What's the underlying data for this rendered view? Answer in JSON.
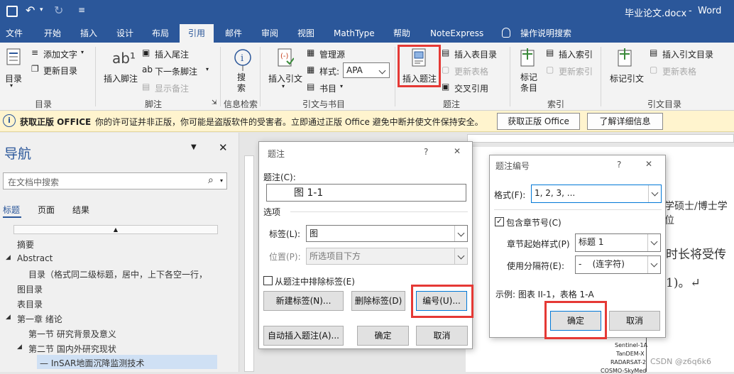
{
  "titlebar": {
    "filename": "毕业论文.docx",
    "dash": "-",
    "app": "Word"
  },
  "tabs": [
    "文件",
    "开始",
    "插入",
    "设计",
    "布局",
    "引用",
    "邮件",
    "审阅",
    "视图",
    "MathType",
    "帮助",
    "NoteExpress",
    "操作说明搜索"
  ],
  "ribbon": {
    "toc": {
      "label": "目录",
      "add_text": "添加文字",
      "update_toc": "更新目录",
      "group": "目录"
    },
    "footnote": {
      "insert": "插入脚注",
      "insert_endnote": "插入尾注",
      "next": "下一条脚注",
      "show": "显示备注",
      "group": "脚注"
    },
    "search": {
      "label": "搜索",
      "group": "信息检索"
    },
    "citation": {
      "insert": "插入引文",
      "manage": "管理源",
      "style_label": "样式:",
      "style_value": "APA",
      "bib": "书目",
      "group": "引文与书目"
    },
    "caption": {
      "insert": "插入题注",
      "table_of_figures": "插入表目录",
      "update_table": "更新表格",
      "cross_ref": "交叉引用",
      "group": "题注"
    },
    "index": {
      "mark": "标记条目",
      "insert": "插入索引",
      "update": "更新索引",
      "group": "索引"
    },
    "authorities": {
      "mark": "标记引文",
      "insert": "插入引文目录",
      "update": "更新表格",
      "group": "引文目录"
    }
  },
  "message_bar": {
    "title": "获取正版 OFFICE",
    "text": "你的许可证并非正版，你可能是盗版软件的受害者。立即通过正版 Office 避免中断并使文件保持安全。",
    "btn_get": "获取正版 Office",
    "btn_more": "了解详细信息"
  },
  "nav": {
    "title": "导航",
    "search_placeholder": "在文档中搜索",
    "tabs": [
      "标题",
      "页面",
      "结果"
    ],
    "items": [
      "摘要",
      "Abstract",
      "目录（格式同二级标题，居中，上下各空一行，",
      "图目录",
      "表目录",
      "第一章 绪论",
      "第一节 研究背景及意义",
      "第二节 国内外研究现状",
      "— InSAR地面沉降监测技术"
    ]
  },
  "doc": {
    "text1": "学硕士/博士学位",
    "text2": "时长将受传",
    "text3": "1)。↵",
    "figure_labels": [
      "Sentinel-1A",
      "TanDEM-X",
      "RADARSAT-2",
      "COSMO-SkyMed"
    ],
    "watermark": "CSDN @z6q6k6"
  },
  "caption_dialog": {
    "title": "题注",
    "help": "?",
    "close": "✕",
    "caption_label": "题注(C):",
    "caption_value": "图  1-1",
    "options": "选项",
    "label_label": "标签(L):",
    "label_value": "图",
    "position_label": "位置(P):",
    "position_value": "所选项目下方",
    "exclude": "从题注中排除标签(E)",
    "new_label": "新建标签(N)...",
    "delete_label": "删除标签(D)",
    "numbering": "编号(U)...",
    "autocaption": "自动插入题注(A)...",
    "ok": "确定",
    "cancel": "取消"
  },
  "numbering_dialog": {
    "title": "题注编号",
    "help": "?",
    "close": "✕",
    "format_label": "格式(F):",
    "format_value": "1, 2, 3, ...",
    "include_chapter": "包含章节号(C)",
    "chapter_style_label": "章节起始样式(P)",
    "chapter_style_value": "标题 1",
    "separator_label": "使用分隔符(E):",
    "separator_value": "-    (连字符)",
    "example": "示例: 图表 II-1，表格 1-A",
    "ok": "确定",
    "cancel": "取消"
  },
  "colors": {
    "accent": "#2b579a",
    "highlight": "#e53935"
  }
}
